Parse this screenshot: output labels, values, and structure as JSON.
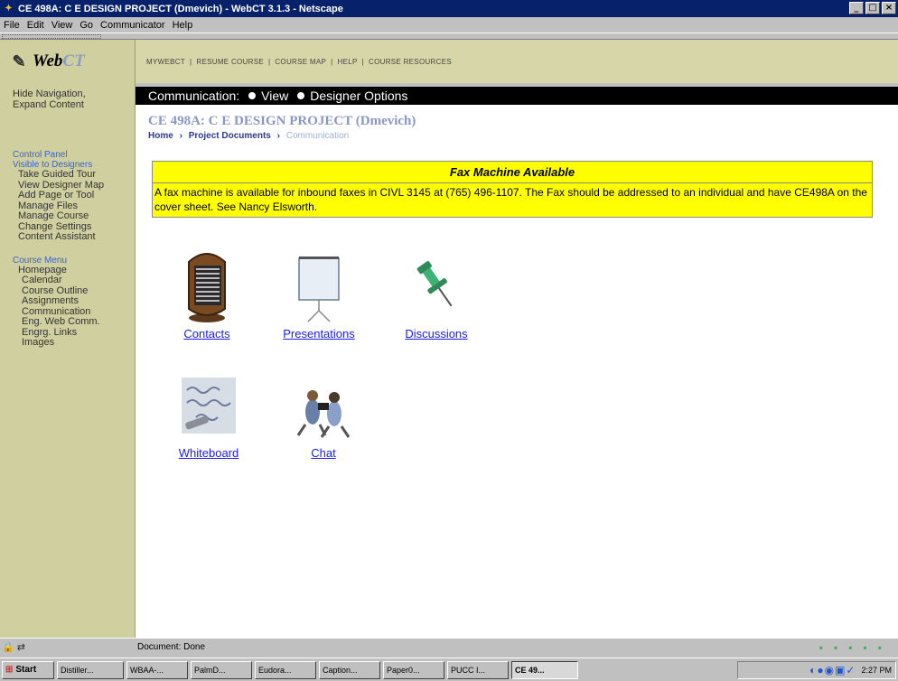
{
  "window": {
    "title": "CE 498A: C E DESIGN PROJECT (Dmevich) - WebCT 3.1.3 - Netscape",
    "buttons": [
      "_",
      "□",
      "×"
    ]
  },
  "menubar": [
    "File",
    "Edit",
    "View",
    "Go",
    "Communicator",
    "Help"
  ],
  "sidebar": {
    "logo_web": "Web",
    "logo_ct": "CT",
    "hide_nav": "Hide Navigation,",
    "expand": "Expand Content",
    "control_panel": "Control Panel",
    "visible_to_designers": "Visible to Designers",
    "designer_items": [
      "Take Guided Tour",
      "View Designer Map",
      "Add Page or Tool",
      "Manage Files",
      "Manage Course",
      "Change Settings",
      "Content Assistant"
    ],
    "course_menu": "Course Menu",
    "homepage": "Homepage",
    "course_items": [
      "Calendar",
      "Course Outline",
      "Assignments",
      "Communication",
      "Eng. Web Comm.",
      "Engrg. Links",
      "Images"
    ]
  },
  "topnav": {
    "links": [
      "MYWEBCT",
      "RESUME COURSE",
      "COURSE MAP",
      "HELP",
      "COURSE RESOURCES"
    ],
    "separator": "|"
  },
  "modebar": {
    "section": "Communication:",
    "view": "View",
    "designer": "Designer Options"
  },
  "main": {
    "course_title": "CE 498A: C E DESIGN PROJECT (Dmevich)",
    "breadcrumb": [
      "Home",
      "Project Documents",
      "Communication"
    ],
    "breadcrumb_arrow": "›",
    "notice_title": "Fax Machine Available",
    "notice_body": "A fax machine is available for inbound faxes in CIVL 3145 at (765) 496-1107. The Fax should be addressed to an individual and have CE498A on the cover sheet. See Nancy Elsworth.",
    "tools": [
      "Contacts",
      "Presentations",
      "Discussions",
      "Whiteboard",
      "Chat"
    ]
  },
  "statusbar": {
    "text": "Document: Done"
  },
  "taskbar": {
    "start": "Start",
    "tasks": [
      "Distiller...",
      "WBAA-...",
      "PalmD...",
      "Eudora...",
      "Caption...",
      "Paper0...",
      "PUCC I...",
      "CE 49..."
    ],
    "active_task": "CE 49...",
    "clock": "2:27 PM"
  }
}
